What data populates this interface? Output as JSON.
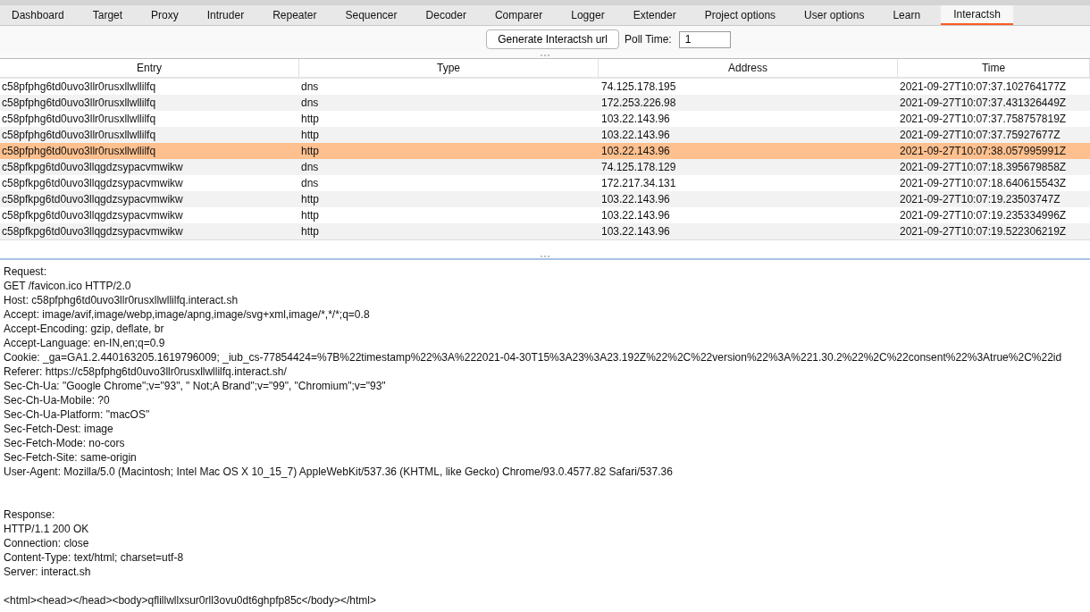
{
  "tabs": [
    {
      "label": "Dashboard",
      "selected": false
    },
    {
      "label": "Target",
      "selected": false
    },
    {
      "label": "Proxy",
      "selected": false
    },
    {
      "label": "Intruder",
      "selected": false
    },
    {
      "label": "Repeater",
      "selected": false
    },
    {
      "label": "Sequencer",
      "selected": false
    },
    {
      "label": "Decoder",
      "selected": false
    },
    {
      "label": "Comparer",
      "selected": false
    },
    {
      "label": "Logger",
      "selected": false
    },
    {
      "label": "Extender",
      "selected": false
    },
    {
      "label": "Project options",
      "selected": false
    },
    {
      "label": "User options",
      "selected": false
    },
    {
      "label": "Learn",
      "selected": false
    },
    {
      "label": "Interactsh",
      "selected": true
    }
  ],
  "toolbar": {
    "generate_button": "Generate Interactsh url",
    "poll_label": "Poll Time:",
    "poll_value": "1"
  },
  "table": {
    "columns": [
      "Entry",
      "Type",
      "Address",
      "Time"
    ],
    "rows": [
      {
        "entry": "c58pfphg6td0uvo3llr0rusxllwllilfq",
        "type": "dns",
        "address": "74.125.178.195",
        "time": "2021-09-27T10:07:37.102764177Z",
        "selected": false
      },
      {
        "entry": "c58pfphg6td0uvo3llr0rusxllwllilfq",
        "type": "dns",
        "address": "172.253.226.98",
        "time": "2021-09-27T10:07:37.431326449Z",
        "selected": false
      },
      {
        "entry": "c58pfphg6td0uvo3llr0rusxllwllilfq",
        "type": "http",
        "address": "103.22.143.96",
        "time": "2021-09-27T10:07:37.758757819Z",
        "selected": false
      },
      {
        "entry": "c58pfphg6td0uvo3llr0rusxllwllilfq",
        "type": "http",
        "address": "103.22.143.96",
        "time": "2021-09-27T10:07:37.75927677Z",
        "selected": false
      },
      {
        "entry": "c58pfphg6td0uvo3llr0rusxllwllilfq",
        "type": "http",
        "address": "103.22.143.96",
        "time": "2021-09-27T10:07:38.057995991Z",
        "selected": true
      },
      {
        "entry": "c58pfkpg6td0uvo3llqgdzsypacvmwikw",
        "type": "dns",
        "address": "74.125.178.129",
        "time": "2021-09-27T10:07:18.395679858Z",
        "selected": false
      },
      {
        "entry": "c58pfkpg6td0uvo3llqgdzsypacvmwikw",
        "type": "dns",
        "address": "172.217.34.131",
        "time": "2021-09-27T10:07:18.640615543Z",
        "selected": false
      },
      {
        "entry": "c58pfkpg6td0uvo3llqgdzsypacvmwikw",
        "type": "http",
        "address": "103.22.143.96",
        "time": "2021-09-27T10:07:19.23503747Z",
        "selected": false
      },
      {
        "entry": "c58pfkpg6td0uvo3llqgdzsypacvmwikw",
        "type": "http",
        "address": "103.22.143.96",
        "time": "2021-09-27T10:07:19.235334996Z",
        "selected": false
      },
      {
        "entry": "c58pfkpg6td0uvo3llqgdzsypacvmwikw",
        "type": "http",
        "address": "103.22.143.96",
        "time": "2021-09-27T10:07:19.522306219Z",
        "selected": false
      }
    ]
  },
  "details": {
    "request": {
      "label": "Request:",
      "lines": [
        "GET /favicon.ico HTTP/2.0",
        "Host: c58pfphg6td0uvo3llr0rusxllwllilfq.interact.sh",
        "Accept: image/avif,image/webp,image/apng,image/svg+xml,image/*,*/*;q=0.8",
        "Accept-Encoding: gzip, deflate, br",
        "Accept-Language: en-IN,en;q=0.9",
        "Cookie: _ga=GA1.2.440163205.1619796009; _iub_cs-77854424=%7B%22timestamp%22%3A%222021-04-30T15%3A23%3A23.192Z%22%2C%22version%22%3A%221.30.2%22%2C%22consent%22%3Atrue%2C%22id",
        "Referer: https://c58pfphg6td0uvo3llr0rusxllwllilfq.interact.sh/",
        "Sec-Ch-Ua: \"Google Chrome\";v=\"93\", \" Not;A Brand\";v=\"99\", \"Chromium\";v=\"93\"",
        "Sec-Ch-Ua-Mobile: ?0",
        "Sec-Ch-Ua-Platform: \"macOS\"",
        "Sec-Fetch-Dest: image",
        "Sec-Fetch-Mode: no-cors",
        "Sec-Fetch-Site: same-origin",
        "User-Agent: Mozilla/5.0 (Macintosh; Intel Mac OS X 10_15_7) AppleWebKit/537.36 (KHTML, like Gecko) Chrome/93.0.4577.82 Safari/537.36"
      ]
    },
    "response": {
      "label": "Response:",
      "lines": [
        "HTTP/1.1 200 OK",
        "Connection: close",
        "Content-Type: text/html; charset=utf-8",
        "Server: interact.sh"
      ]
    },
    "body": "<html><head></head><body>qflillwllxsur0rll3ovu0dt6ghpfp85c</body></html>"
  }
}
